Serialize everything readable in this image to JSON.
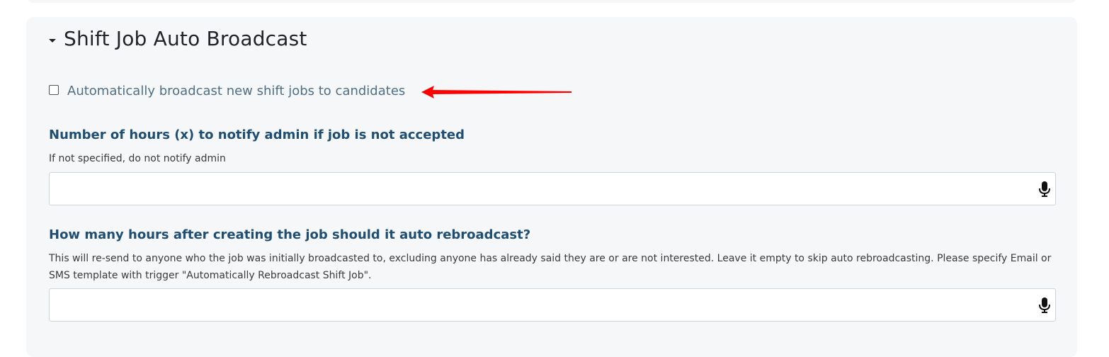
{
  "section": {
    "title": "Shift Job Auto Broadcast",
    "caret_icon": "caret-down-icon"
  },
  "auto_broadcast": {
    "label": "Automatically broadcast new shift jobs to candidates",
    "checked": false,
    "annotation_arrow_color": "#ff0000"
  },
  "notify_hours": {
    "label": "Number of hours (x) to notify admin if job is not accepted",
    "help": "If not specified, do not notify admin",
    "value": "",
    "mic_icon": "microphone-icon"
  },
  "rebroadcast_hours": {
    "label": "How many hours after creating the job should it auto rebroadcast?",
    "help": "This will re-send to anyone who the job was initially broadcasted to, excluding anyone has already said they are or are not interested. Leave it empty to skip auto rebroadcasting. Please specify Email or SMS template with trigger \"Automatically Rebroadcast Shift Job\".",
    "value": "",
    "mic_icon": "microphone-icon"
  },
  "colors": {
    "panel_bg": "#f6f7f9",
    "label_color": "#1f4e73",
    "checkbox_label_color": "#4f6f86"
  }
}
